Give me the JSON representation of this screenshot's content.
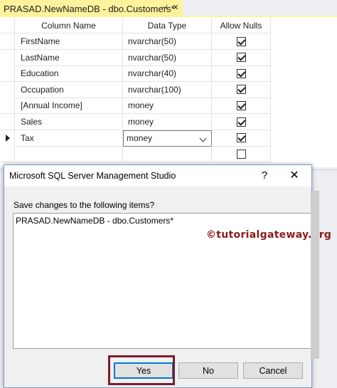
{
  "document_tab": {
    "title": "PRASAD.NewNameDB - dbo.Customers*",
    "pin_glyph": "⊣",
    "close_glyph": "✕"
  },
  "grid": {
    "headers": {
      "column_name": "Column Name",
      "data_type": "Data Type",
      "allow_nulls": "Allow Nulls"
    },
    "rows": [
      {
        "name": "FirstName",
        "type": "nvarchar(50)",
        "allow_nulls": true
      },
      {
        "name": "LastName",
        "type": "nvarchar(50)",
        "allow_nulls": true
      },
      {
        "name": "Education",
        "type": "nvarchar(40)",
        "allow_nulls": true
      },
      {
        "name": "Occupation",
        "type": "nvarchar(100)",
        "allow_nulls": true
      },
      {
        "name": "[Annual Income]",
        "type": "money",
        "allow_nulls": true
      },
      {
        "name": "Sales",
        "type": "money",
        "allow_nulls": true
      },
      {
        "name": "Tax",
        "type": "money",
        "allow_nulls": true,
        "current": true
      },
      {
        "name": "",
        "type": "",
        "allow_nulls": false
      }
    ]
  },
  "dialog": {
    "title": "Microsoft SQL Server Management Studio",
    "help_glyph": "?",
    "close_glyph": "✕",
    "prompt": "Save changes to the following items?",
    "items": [
      "PRASAD.NewNameDB - dbo.Customers*"
    ],
    "watermark": "©tutorialgateway.org",
    "buttons": {
      "yes": "Yes",
      "no": "No",
      "cancel": "Cancel"
    }
  },
  "colors": {
    "tab_accent": "#fff29d",
    "highlight": "#7b1c2c",
    "watermark": "#8b1a1a",
    "focus_blue": "#0078d7"
  }
}
